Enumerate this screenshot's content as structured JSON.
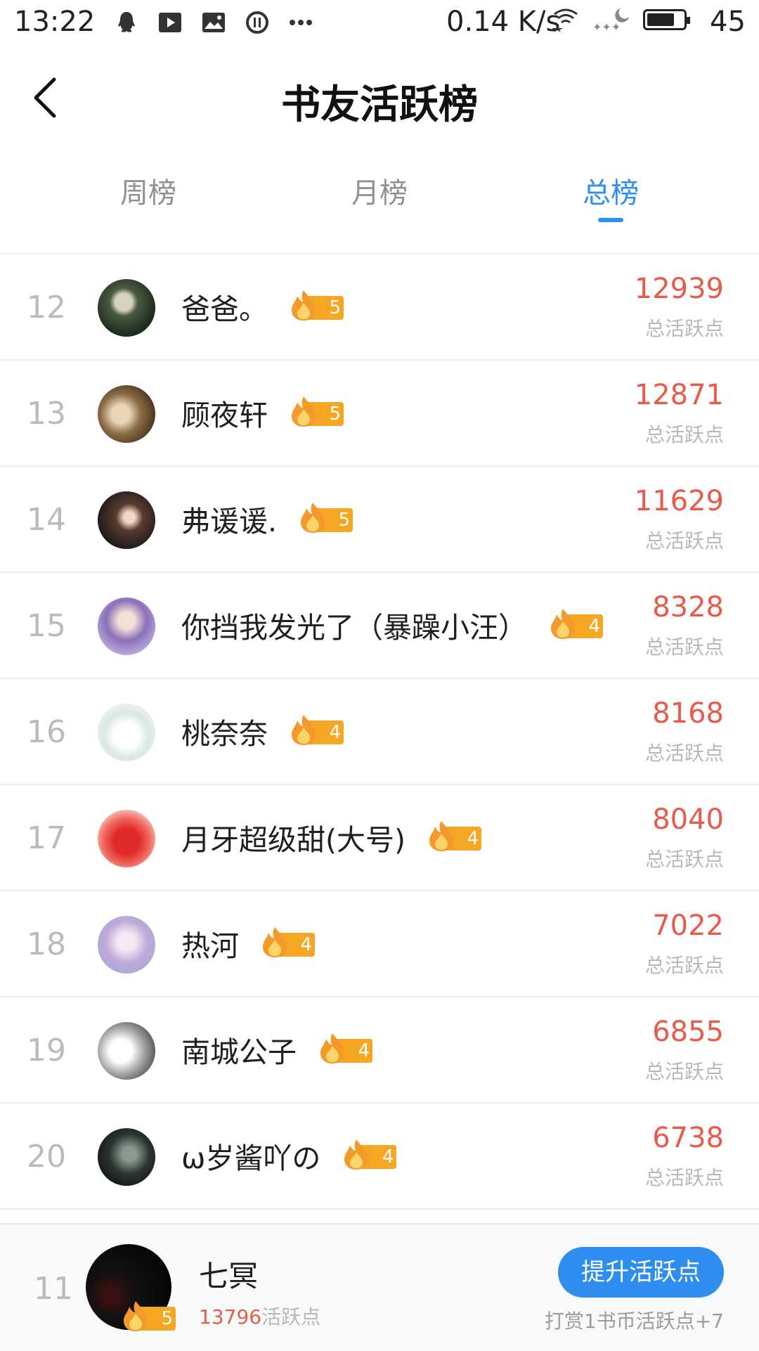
{
  "status_bar": {
    "time": "13:22",
    "net_speed": "0.14 K/s",
    "battery": "45",
    "icons": [
      "qq-icon",
      "video-icon",
      "image-icon",
      "pause-icon",
      "more-dots-icon",
      "wifi-icon",
      "night-icon",
      "battery-icon"
    ]
  },
  "header": {
    "title": "书友活跃榜",
    "back_icon": "chevron-left-icon"
  },
  "tabs": [
    {
      "label": "周榜",
      "active": false
    },
    {
      "label": "月榜",
      "active": false
    },
    {
      "label": "总榜",
      "active": true
    }
  ],
  "rows": [
    {
      "rank": "12",
      "name": "爸爸。",
      "level": "5",
      "score": "12939",
      "score_label": "总活跃点"
    },
    {
      "rank": "13",
      "name": "顾夜轩",
      "level": "5",
      "score": "12871",
      "score_label": "总活跃点"
    },
    {
      "rank": "14",
      "name": "弗谖谖.",
      "level": "5",
      "score": "11629",
      "score_label": "总活跃点"
    },
    {
      "rank": "15",
      "name": "你挡我发光了（暴躁小汪）",
      "level": "4",
      "score": "8328",
      "score_label": "总活跃点"
    },
    {
      "rank": "16",
      "name": "桃奈奈",
      "level": "4",
      "score": "8168",
      "score_label": "总活跃点"
    },
    {
      "rank": "17",
      "name": "月牙超级甜(大号)",
      "level": "4",
      "score": "8040",
      "score_label": "总活跃点"
    },
    {
      "rank": "18",
      "name": "热河",
      "level": "4",
      "score": "7022",
      "score_label": "总活跃点"
    },
    {
      "rank": "19",
      "name": "南城公子",
      "level": "4",
      "score": "6855",
      "score_label": "总活跃点"
    },
    {
      "rank": "20",
      "name": "ω岁酱吖の",
      "level": "4",
      "score": "6738",
      "score_label": "总活跃点"
    }
  ],
  "me": {
    "rank": "11",
    "name": "七冥",
    "level": "5",
    "score": "13796",
    "score_label": "活跃点",
    "button_label": "提升活跃点",
    "hint": "打赏1书币活跃点+7"
  },
  "colors": {
    "accent": "#2d8ef0",
    "score": "#e85b4b",
    "badge": "#f5a623"
  }
}
